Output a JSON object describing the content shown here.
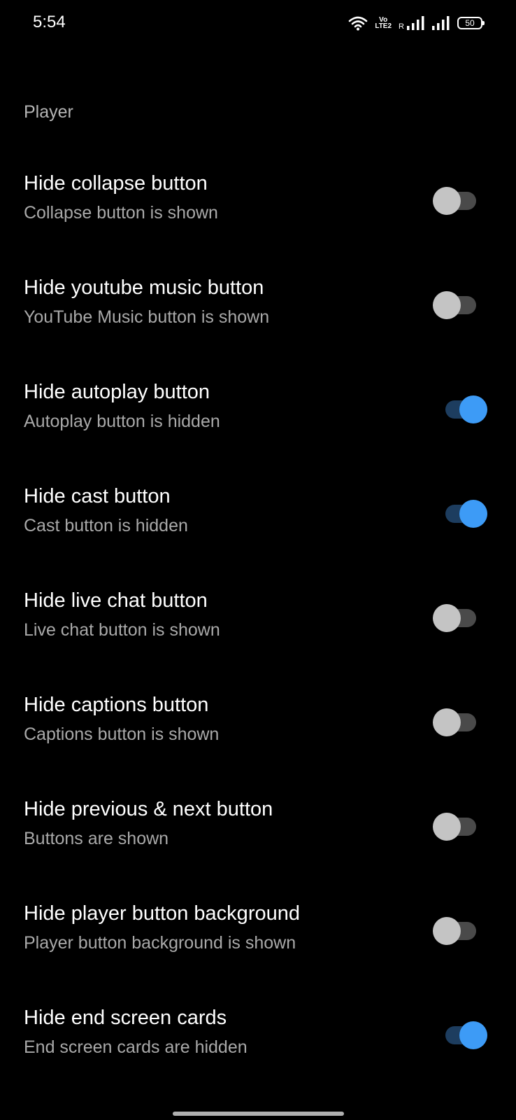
{
  "status_bar": {
    "time": "5:54",
    "volte_top": "Vo",
    "volte_bottom": "LTE2",
    "roaming": "R",
    "battery": "50",
    "icons": [
      "wifi-icon",
      "volte-icon",
      "signal-icon",
      "signal-icon",
      "battery-icon"
    ]
  },
  "section": {
    "title": "Player"
  },
  "settings": [
    {
      "title": "Hide collapse button",
      "summary": "Collapse button is shown",
      "enabled": false
    },
    {
      "title": "Hide youtube music button",
      "summary": "YouTube Music button is shown",
      "enabled": false
    },
    {
      "title": "Hide autoplay button",
      "summary": "Autoplay button is hidden",
      "enabled": true
    },
    {
      "title": "Hide cast button",
      "summary": "Cast button is hidden",
      "enabled": true
    },
    {
      "title": "Hide live chat button",
      "summary": "Live chat button is shown",
      "enabled": false
    },
    {
      "title": "Hide captions button",
      "summary": "Captions button is shown",
      "enabled": false
    },
    {
      "title": "Hide previous & next button",
      "summary": "Buttons are shown",
      "enabled": false
    },
    {
      "title": "Hide player button background",
      "summary": "Player button background is shown",
      "enabled": false
    },
    {
      "title": "Hide end screen cards",
      "summary": "End screen cards are hidden",
      "enabled": true
    }
  ],
  "colors": {
    "background": "#000000",
    "toggle_on_thumb": "#3d9bf6",
    "toggle_on_track": "#1d3d5f",
    "toggle_off_thumb": "#c4c4c4",
    "toggle_off_track": "#4a4a4a",
    "summary_text": "#a9a9a9"
  }
}
